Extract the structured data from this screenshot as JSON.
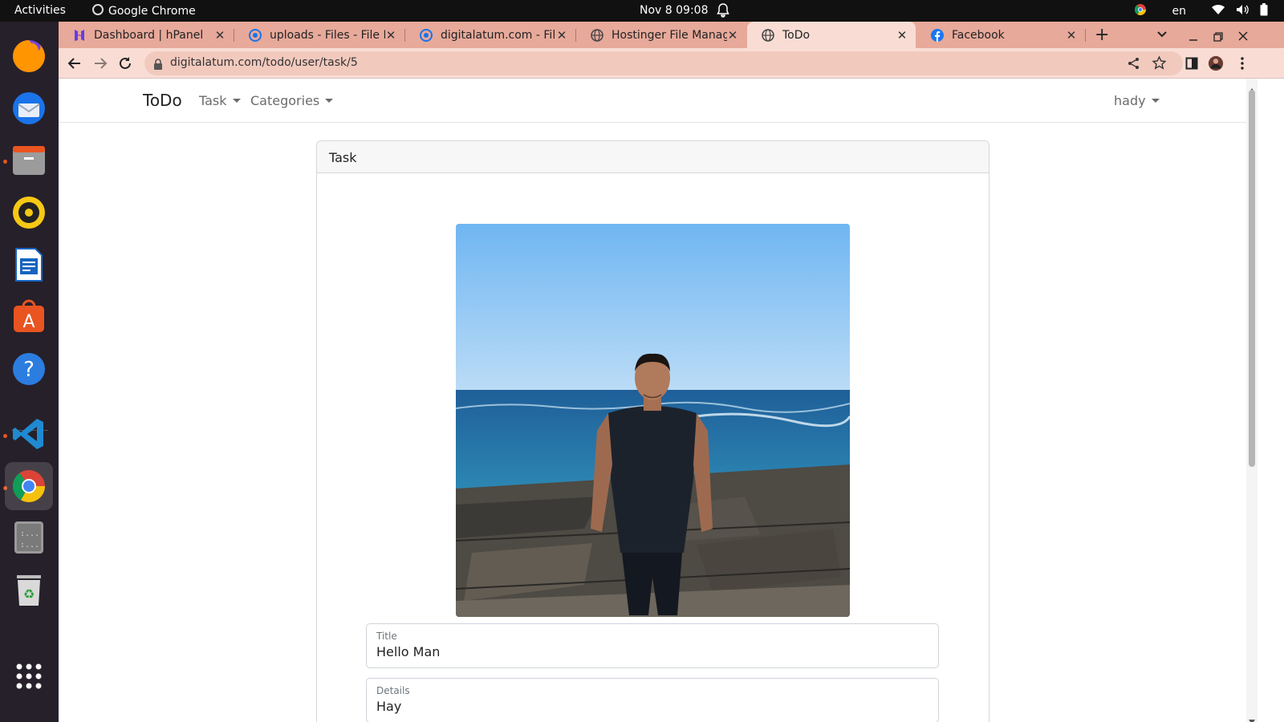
{
  "system_bar": {
    "activities": "Activities",
    "app_name": "Google Chrome",
    "clock": "Nov 8  09:08",
    "language": "en"
  },
  "dock": {
    "items": [
      {
        "name": "firefox-icon",
        "color": "#ff7139"
      },
      {
        "name": "thunderbird-icon",
        "color": "#2a7fd4"
      },
      {
        "name": "files-icon",
        "color": "#c9604c"
      },
      {
        "name": "rhythmbox-icon",
        "color": "#f6c915"
      },
      {
        "name": "writer-icon",
        "color": "#1565c0"
      },
      {
        "name": "app-center-icon",
        "color": "#e95420"
      },
      {
        "name": "help-icon",
        "color": "#2b7de0"
      },
      {
        "name": "vscode-icon",
        "color": "#1f8ad2"
      },
      {
        "name": "chrome-icon",
        "color": "#4285f4"
      },
      {
        "name": "terminal-icon",
        "color": "#3a3a3a"
      },
      {
        "name": "trash-icon",
        "color": "#cfcfcf"
      },
      {
        "name": "show-apps-icon",
        "color": "#ffffff"
      }
    ]
  },
  "browser": {
    "tabs": [
      {
        "label": "Dashboard | hPanel",
        "active": false
      },
      {
        "label": "uploads - Files - File Br",
        "active": false
      },
      {
        "label": "digitalatum.com - Files",
        "active": false
      },
      {
        "label": "Hostinger File Manage",
        "active": false
      },
      {
        "label": "ToDo",
        "active": true
      },
      {
        "label": "Facebook",
        "active": false
      }
    ],
    "new_tab": "+",
    "url": "digitalatum.com/todo/user/task/5",
    "theme_color": "#e7a99a"
  },
  "navbar": {
    "brand": "ToDo",
    "links": [
      "Task",
      "Categories"
    ],
    "user": "hady"
  },
  "card": {
    "header": "Task",
    "image_alt": "Man standing on rocks by the sea",
    "fields": [
      {
        "label": "Title",
        "value": "Hello Man"
      },
      {
        "label": "Details",
        "value": "Hay"
      }
    ]
  }
}
